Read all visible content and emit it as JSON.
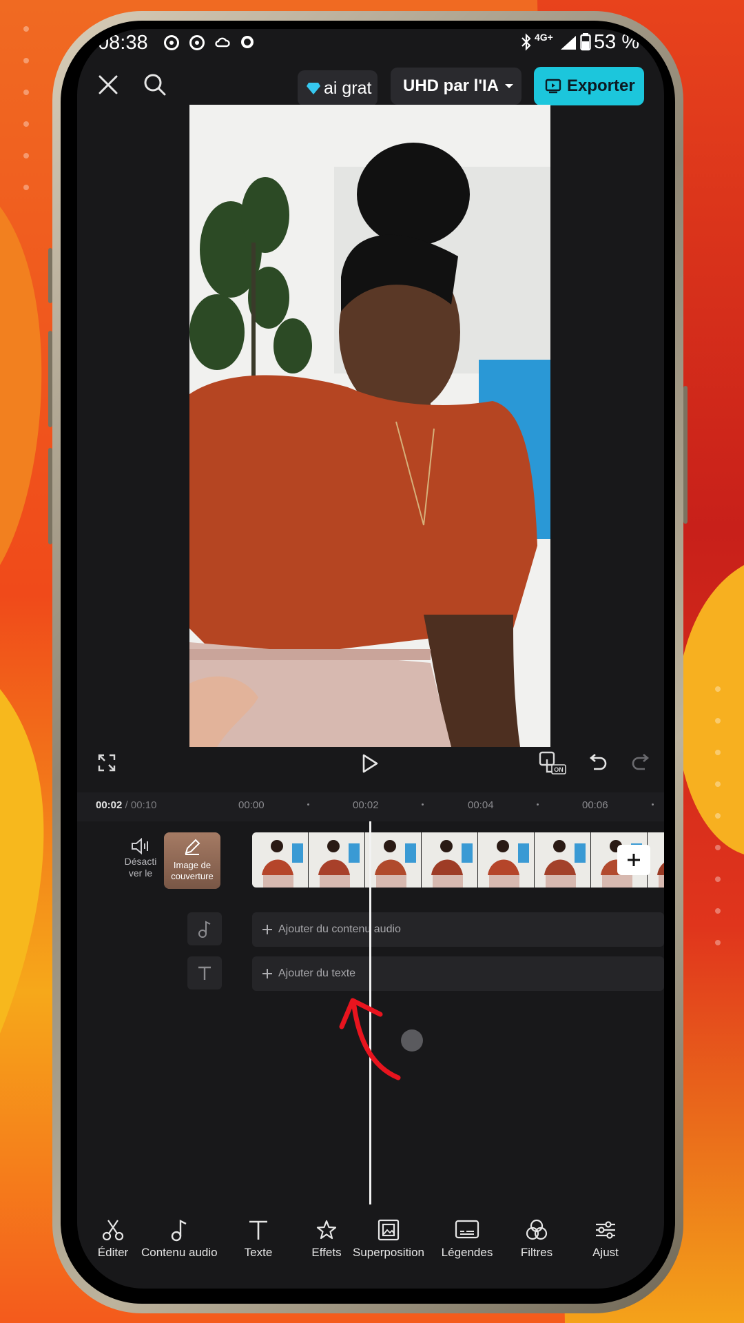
{
  "status_bar": {
    "time": "08:38",
    "network": "4G+",
    "battery": "53 %"
  },
  "top_bar": {
    "free_trial_label": "ai grat",
    "quality_label": "UHD par l'IA",
    "export_label": "Exporter"
  },
  "timeline": {
    "current_time": "00:02",
    "separator": " / ",
    "total_time": "00:10",
    "ruler_marks": [
      "00:00",
      "00:02",
      "00:04",
      "00:06"
    ],
    "mute_label_line1": "Désacti",
    "mute_label_line2": "ver le",
    "cover_label_line1": "Image de",
    "cover_label_line2": "couverture",
    "add_audio_label": "Ajouter du contenu audio",
    "add_text_label": "Ajouter du texte"
  },
  "toolbar": {
    "items": [
      {
        "label": "Éditer",
        "icon": "scissors-icon"
      },
      {
        "label": "Contenu audio",
        "icon": "music-note-icon"
      },
      {
        "label": "Texte",
        "icon": "text-icon"
      },
      {
        "label": "Effets",
        "icon": "star-effects-icon"
      },
      {
        "label": "Superposition",
        "icon": "overlay-icon"
      },
      {
        "label": "Légendes",
        "icon": "captions-icon"
      },
      {
        "label": "Filtres",
        "icon": "filters-icon"
      },
      {
        "label": "Ajust",
        "icon": "adjust-sliders-icon"
      }
    ]
  },
  "colors": {
    "accent": "#1cc6dc",
    "annotation_arrow": "#e8141e",
    "screen_bg": "#18181a"
  }
}
